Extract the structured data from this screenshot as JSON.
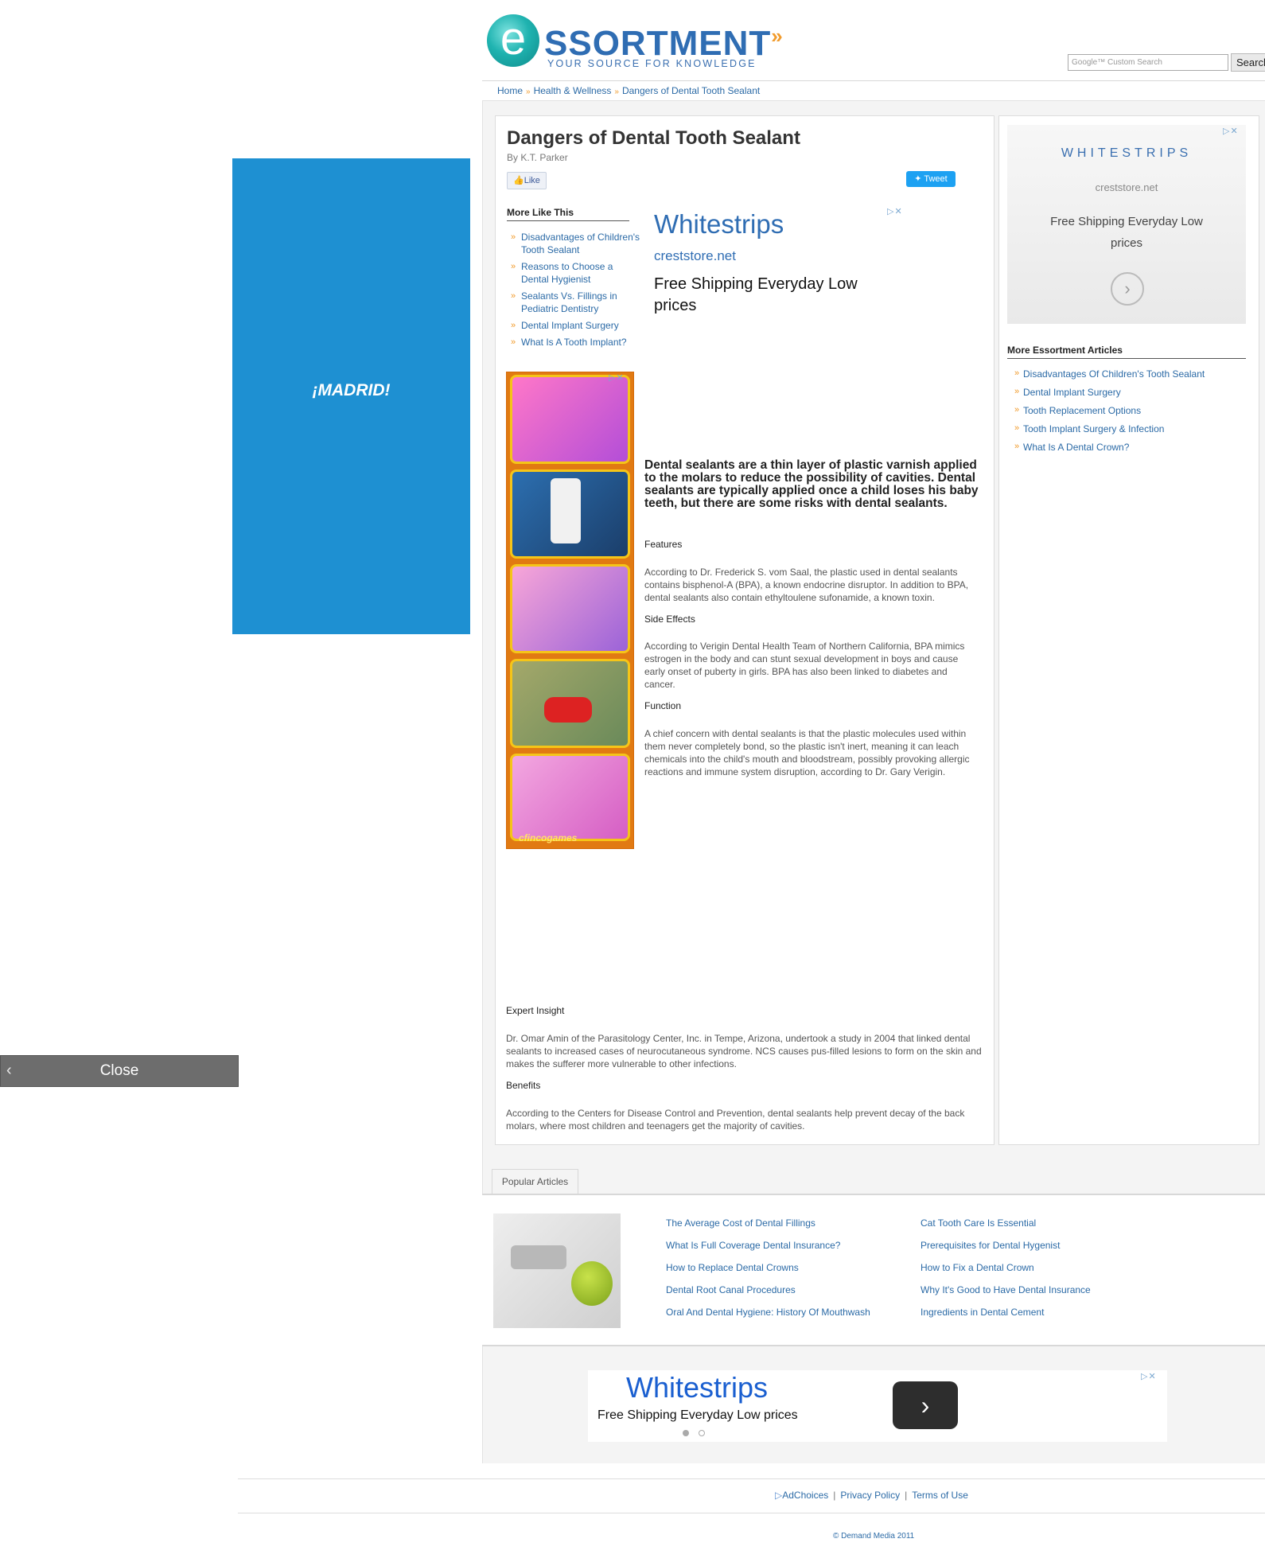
{
  "header": {
    "logo_letter": "e",
    "logo_text": "SSORTMENT",
    "logo_chevron": "»",
    "tagline": "YOUR SOURCE FOR KNOWLEDGE",
    "search_placeholder": "Google™ Custom Search",
    "search_button": "Search"
  },
  "breadcrumb": [
    "Home",
    "Health & Wellness",
    "Dangers of Dental Tooth Sealant"
  ],
  "breadcrumb_sep": "»",
  "article": {
    "title": "Dangers of Dental Tooth Sealant",
    "byline": "By K.T. Parker",
    "like_label": "Like",
    "tweet_label": "Tweet",
    "lead": "Dental sealants are a thin layer of plastic varnish applied to the molars to reduce the possibility of cavities. Dental sealants are typically applied once a child loses his baby teeth, but there are some risks with dental sealants.",
    "sections": [
      {
        "heading": "Features",
        "text": "According to Dr. Frederick S. vom Saal, the plastic used in dental sealants contains bisphenol-A (BPA), a known endocrine disruptor. In addition to BPA, dental sealants also contain ethyltoulene sufonamide, a known toxin."
      },
      {
        "heading": "Side Effects",
        "text": "According to Verigin Dental Health Team of Northern California, BPA mimics estrogen in the body and can stunt sexual development in boys and cause early onset of puberty in girls. BPA has also been linked to diabetes and cancer."
      },
      {
        "heading": "Function",
        "text": "A chief concern with dental sealants is that the plastic molecules used within them never completely bond, so the plastic isn't inert, meaning it can leach chemicals into the child's mouth and bloodstream, possibly provoking allergic reactions and immune system disruption, according to Dr. Gary Verigin."
      },
      {
        "heading": "Expert Insight",
        "text": "Dr. Omar Amin of the Parasitology Center, Inc. in Tempe, Arizona, undertook a study in 2004 that linked dental sealants to increased cases of neurocutaneous syndrome. NCS causes pus-filled lesions to form on the skin and makes the sufferer more vulnerable to other infections."
      },
      {
        "heading": "Benefits",
        "text": "According to the Centers for Disease Control and Prevention, dental sealants help prevent decay of the back molars, where most children and teenagers get the majority of cavities."
      }
    ]
  },
  "more_like_this": {
    "title": "More Like This",
    "items": [
      "Disadvantages of Children's Tooth Sealant",
      "Reasons to Choose a Dental Hygienist",
      "Sealants Vs. Fillings in Pediatric Dentistry",
      "Dental Implant Surgery",
      "What Is A Tooth Implant?"
    ]
  },
  "ad_inline": {
    "title": "Whitestrips",
    "url": "creststore.net",
    "text": "Free Shipping Everyday Low prices"
  },
  "ad_games": {
    "logo": "cfincogames"
  },
  "ad_left": {
    "text": "¡MADRID!",
    "close_label": "Close",
    "close_icon": "chevron-left-icon"
  },
  "ad_right": {
    "title": "WHITESTRIPS",
    "url": "creststore.net",
    "text": "Free Shipping Everyday Low prices"
  },
  "more_essortment": {
    "title": "More Essortment Articles",
    "items": [
      "Disadvantages Of Children's Tooth Sealant",
      "Dental Implant Surgery",
      "Tooth Replacement Options",
      "Tooth Implant Surgery & Infection",
      "What Is A Dental Crown?"
    ]
  },
  "popular": {
    "tab_label": "Popular Articles",
    "col1": [
      "The Average Cost of Dental Fillings",
      "What Is Full Coverage Dental Insurance?",
      "How to Replace Dental Crowns",
      "Dental Root Canal Procedures",
      "Oral And Dental Hygiene: History Of Mouthwash"
    ],
    "col2": [
      "Cat Tooth Care Is Essential",
      "Prerequisites for Dental Hygenist",
      "How to Fix a Dental Crown",
      "Why It's Good to Have Dental Insurance",
      "Ingredients in Dental Cement"
    ]
  },
  "ad_bottom": {
    "title": "Whitestrips",
    "text": "Free Shipping Everyday Low prices",
    "button_icon": "chevron-right-icon"
  },
  "footer": {
    "links": [
      "AdChoices",
      "Privacy Policy",
      "Terms of Use"
    ],
    "copyright": "© Demand Media 2011"
  },
  "colors": {
    "brand_blue": "#2f6db3",
    "brand_orange": "#f19b2c",
    "link": "#2b6aa6",
    "left_ad_blue": "#1e90d2"
  }
}
